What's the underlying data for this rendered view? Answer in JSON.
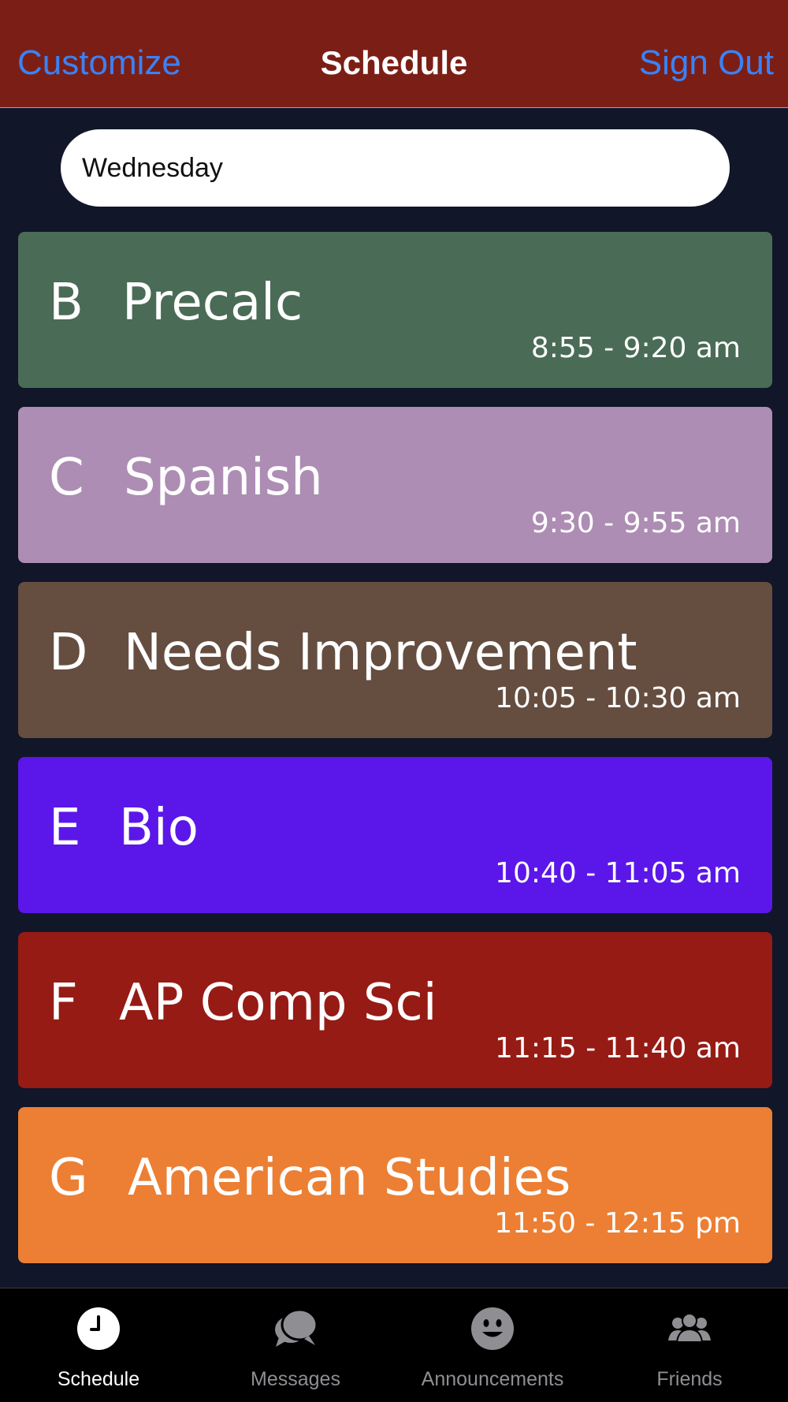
{
  "header": {
    "left_label": "Customize",
    "title": "Schedule",
    "right_label": "Sign Out"
  },
  "day_picker": {
    "value": "Wednesday"
  },
  "classes": [
    {
      "block": "B",
      "name": "Precalc",
      "time": "8:55 - 9:20 am",
      "color": "#4a6b55"
    },
    {
      "block": "C",
      "name": "Spanish",
      "time": "9:30 - 9:55 am",
      "color": "#ad8db4"
    },
    {
      "block": "D",
      "name": "Needs Improvement",
      "time": "10:05 - 10:30 am",
      "color": "#654d40"
    },
    {
      "block": "E",
      "name": "Bio",
      "time": "10:40 - 11:05 am",
      "color": "#5b17e9"
    },
    {
      "block": "F",
      "name": "AP Comp Sci",
      "time": "11:15 - 11:40 am",
      "color": "#961b15"
    },
    {
      "block": "G",
      "name": "American Studies",
      "time": "11:50 - 12:15 pm",
      "color": "#ec7f33"
    }
  ],
  "tabs": [
    {
      "label": "Schedule",
      "icon": "clock-icon",
      "active": true
    },
    {
      "label": "Messages",
      "icon": "chat-bubbles-icon",
      "active": false
    },
    {
      "label": "Announcements",
      "icon": "smiley-face-icon",
      "active": false
    },
    {
      "label": "Friends",
      "icon": "people-icon",
      "active": false
    }
  ],
  "colors": {
    "header_bg": "#7b1f16",
    "page_bg": "#111629",
    "link": "#3a82f6",
    "tabbar_bg": "#000000"
  }
}
